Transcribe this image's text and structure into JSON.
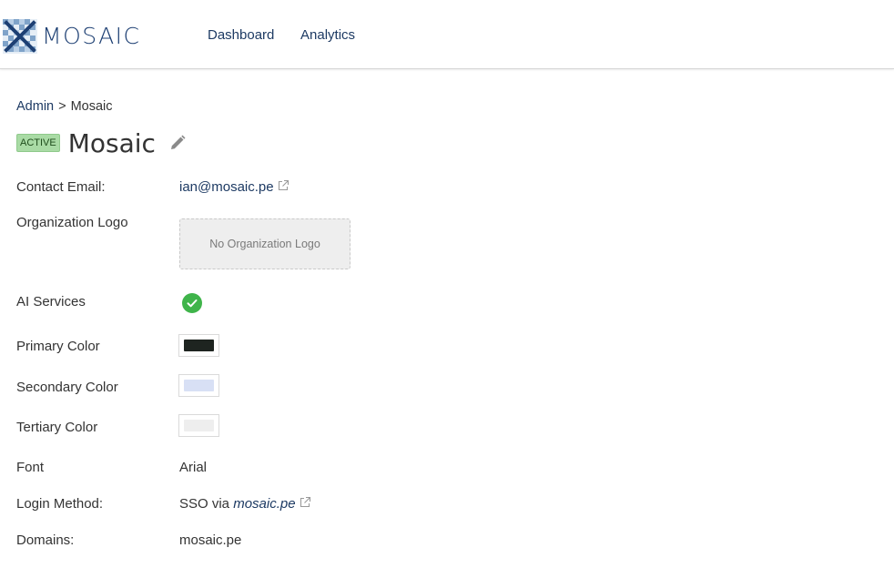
{
  "header": {
    "brand": "MOSAIC",
    "nav": [
      {
        "label": "Dashboard"
      },
      {
        "label": "Analytics"
      }
    ]
  },
  "breadcrumb": {
    "parent": "Admin",
    "separator": ">",
    "current": "Mosaic"
  },
  "org": {
    "status_badge": "ACTIVE",
    "name": "Mosaic"
  },
  "fields": {
    "contact_email": {
      "label": "Contact Email:",
      "value": "ian@mosaic.pe"
    },
    "org_logo": {
      "label": "Organization Logo",
      "placeholder": "No Organization Logo"
    },
    "ai_services": {
      "label": "AI Services",
      "enabled": true
    },
    "primary_color": {
      "label": "Primary Color",
      "color": "#1e2420"
    },
    "secondary_color": {
      "label": "Secondary Color",
      "color": "#d8e0f5"
    },
    "tertiary_color": {
      "label": "Tertiary Color",
      "color": "#eeeeee"
    },
    "font": {
      "label": "Font",
      "value": "Arial"
    },
    "login_method": {
      "label": "Login Method:",
      "prefix": "SSO via",
      "domain": "mosaic.pe"
    },
    "domains": {
      "label": "Domains:",
      "value": "mosaic.pe"
    }
  },
  "colors": {
    "accent": "#1d3a63",
    "badge_bg": "#a9dba5",
    "check_green": "#3fb44a"
  }
}
